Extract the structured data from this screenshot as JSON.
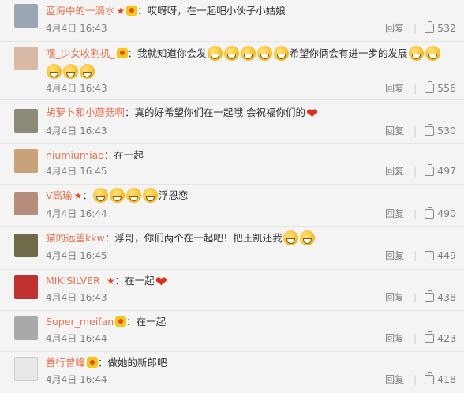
{
  "comments": [
    {
      "user": "蓝海中的一滴水",
      "star": true,
      "badge": true,
      "text": "：哎呀呀，在一起吧小伙子小姑娘",
      "emoji_count": 0,
      "heart": false,
      "time": "4月4日 16:43",
      "reply": "回复",
      "likes": "532",
      "avatar_color": "#9aa6b2"
    },
    {
      "user": "嘿_少女收割机_",
      "star": false,
      "badge": true,
      "text": "：我就知道你会发",
      "emoji_count": 5,
      "text_after": "希望你俩会有进一步的发展",
      "emoji_after": 2,
      "emoji_line2": 3,
      "heart": false,
      "time": "4月4日 16:43",
      "reply": "回复",
      "likes": "556",
      "avatar_color": "#d9b9a6"
    },
    {
      "user": "胡萝卜和小蘑菇啊",
      "star": false,
      "badge": false,
      "text": "：真的好希望你们在一起哦 会祝福你们的",
      "emoji_count": 0,
      "heart": true,
      "time": "4月4日 16:43",
      "reply": "回复",
      "likes": "530",
      "avatar_color": "#8e8a7a"
    },
    {
      "user": "niumiumiao",
      "star": false,
      "badge": false,
      "text": "：在一起",
      "emoji_count": 0,
      "heart": false,
      "time": "4月4日 16:45",
      "reply": "回复",
      "likes": "497",
      "avatar_color": "#c9a27a"
    },
    {
      "user": "V高瑜",
      "star": true,
      "badge": false,
      "text": "：",
      "emoji_count": 4,
      "text_after": "浮恩恋",
      "heart": false,
      "time": "4月4日 16:44",
      "reply": "回复",
      "likes": "490",
      "avatar_color": "#b88c7a"
    },
    {
      "user": "猫的远望kkw",
      "star": false,
      "badge": false,
      "text": "：浮哥，你们两个在一起吧！把王凯还我",
      "emoji_count": 0,
      "laugh": 2,
      "heart": false,
      "time": "4月4日 16:45",
      "reply": "回复",
      "likes": "449",
      "avatar_color": "#6f6a4a"
    },
    {
      "user": "MIKISILVER_",
      "star": true,
      "badge": false,
      "text": "：在一起",
      "emoji_count": 0,
      "heart": true,
      "time": "4月4日 16:43",
      "reply": "回复",
      "likes": "438",
      "avatar_color": "#c0302e"
    },
    {
      "user": "Super_meifan",
      "star": false,
      "badge": true,
      "text": "：在一起",
      "emoji_count": 0,
      "heart": false,
      "time": "4月4日 16:44",
      "reply": "回复",
      "likes": "423",
      "avatar_color": "#a9a9a9"
    },
    {
      "user": "善行曾峰",
      "star": false,
      "badge": true,
      "text": "：做她的新郎吧",
      "emoji_count": 0,
      "heart": false,
      "time": "4月4日 16:44",
      "reply": "回复",
      "likes": "418",
      "avatar_color": "#e8e8e8"
    }
  ]
}
